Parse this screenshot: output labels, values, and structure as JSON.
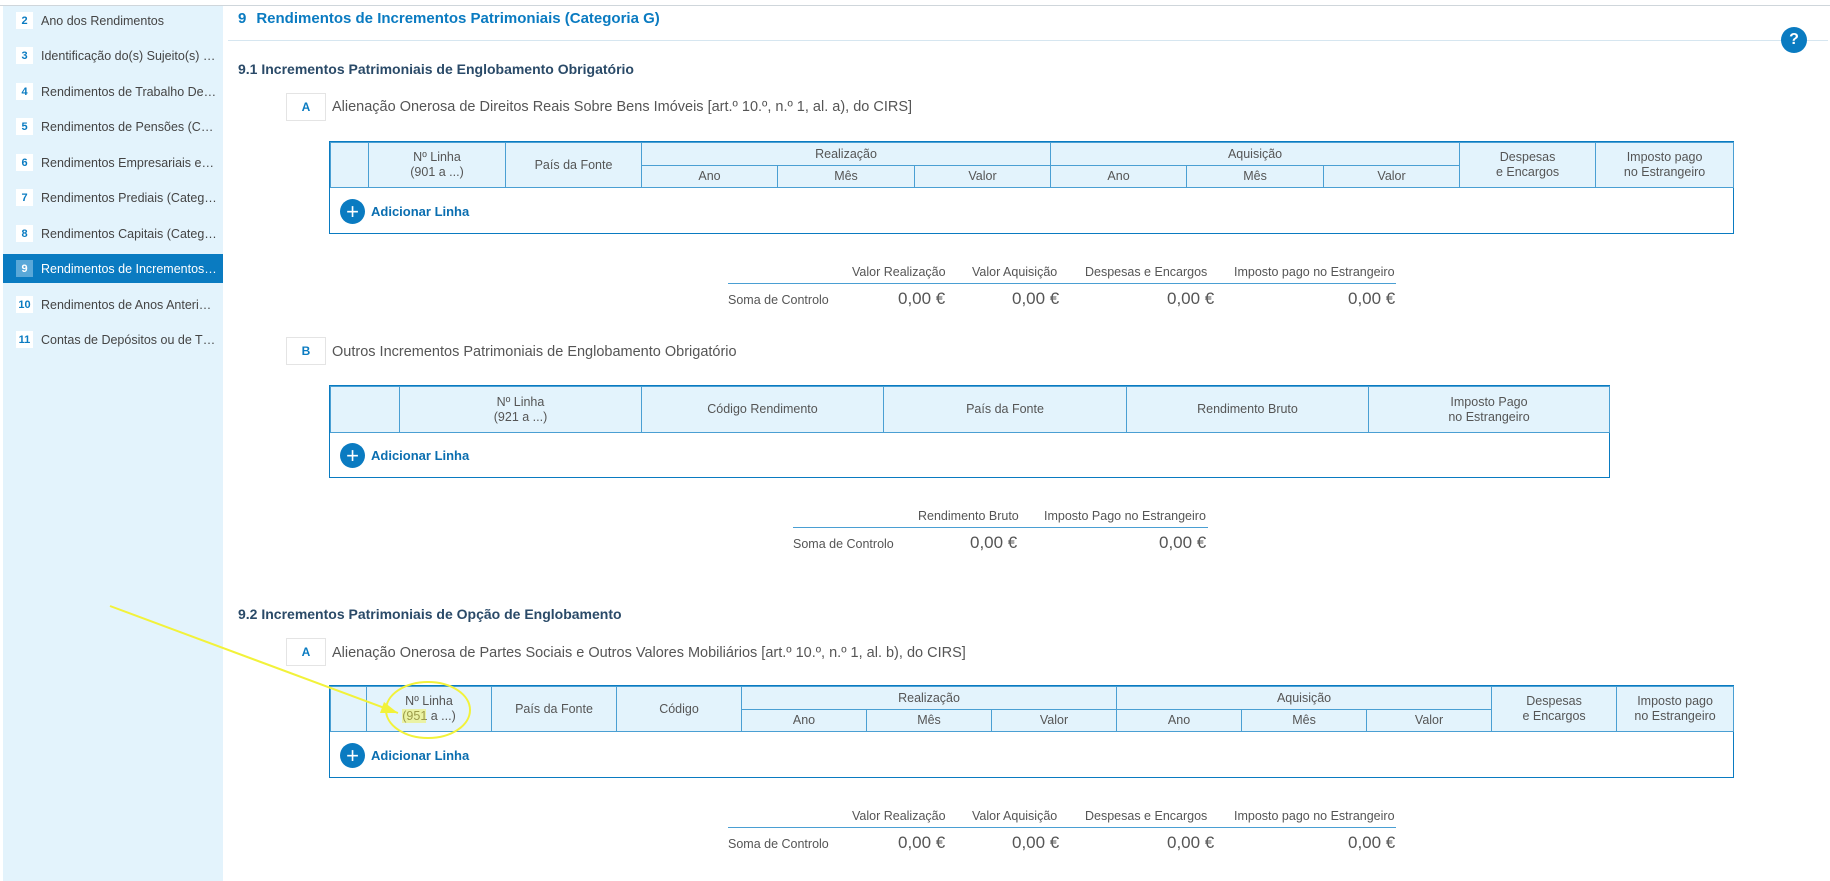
{
  "sidebar": {
    "items": [
      {
        "num": "2",
        "label": "Ano dos Rendimentos"
      },
      {
        "num": "3",
        "label": "Identificação do(s) Sujeito(s) Passivo(s)"
      },
      {
        "num": "4",
        "label": "Rendimentos de Trabalho Dependente"
      },
      {
        "num": "5",
        "label": "Rendimentos de Pensões (Categoria H)"
      },
      {
        "num": "6",
        "label": "Rendimentos Empresariais e Profissionais"
      },
      {
        "num": "7",
        "label": "Rendimentos Prediais (Categoria F)"
      },
      {
        "num": "8",
        "label": "Rendimentos Capitais (Categoria E)"
      },
      {
        "num": "9",
        "label": "Rendimentos de Incrementos Patrimoniais"
      },
      {
        "num": "10",
        "label": "Rendimentos de Anos Anteriores"
      },
      {
        "num": "11",
        "label": "Contas de Depósitos ou de Títulos"
      }
    ],
    "active_index": 7
  },
  "header": {
    "number": "9",
    "title": "Rendimentos de Incrementos Patrimoniais (Categoria G)",
    "help": "?"
  },
  "section_91": {
    "title": "9.1 Incrementos Patrimoniais de Englobamento Obrigatório",
    "A": {
      "letter": "A",
      "title": "Alienação Onerosa de Direitos Reais Sobre Bens Imóveis [art.º 10.º, n.º 1, al. a), do CIRS]",
      "columns": {
        "linha_1": "Nº Linha",
        "linha_2": "(901 a ...)",
        "pais": "País da Fonte",
        "realizacao": "Realização",
        "aquisicao": "Aquisição",
        "despesas_1": "Despesas",
        "despesas_2": "e Encargos",
        "imposto_1": "Imposto pago",
        "imposto_2": "no Estrangeiro",
        "ano": "Ano",
        "mes": "Mês",
        "valor": "Valor"
      },
      "add_label": "Adicionar Linha",
      "summary": {
        "headers": [
          "Valor Realização",
          "Valor Aquisição",
          "Despesas e Encargos",
          "Imposto pago no Estrangeiro"
        ],
        "label": "Soma de Controlo",
        "values": [
          "0,00 €",
          "0,00 €",
          "0,00 €",
          "0,00 €"
        ]
      }
    },
    "B": {
      "letter": "B",
      "title": "Outros Incrementos Patrimoniais de Englobamento Obrigatório",
      "columns": {
        "linha_1": "Nº Linha",
        "linha_2": "(921 a ...)",
        "codigo": "Código Rendimento",
        "pais": "País da Fonte",
        "bruto": "Rendimento Bruto",
        "imposto_1": "Imposto Pago",
        "imposto_2": "no Estrangeiro"
      },
      "add_label": "Adicionar Linha",
      "summary": {
        "headers": [
          "Rendimento Bruto",
          "Imposto Pago no Estrangeiro"
        ],
        "label": "Soma de Controlo",
        "values": [
          "0,00 €",
          "0,00 €"
        ]
      }
    }
  },
  "section_92": {
    "title": "9.2 Incrementos Patrimoniais de Opção de Englobamento",
    "A": {
      "letter": "A",
      "title": "Alienação Onerosa de Partes Sociais e Outros Valores Mobiliários [art.º 10.º, n.º 1, al. b), do CIRS]",
      "columns": {
        "linha_1": "Nº Linha",
        "linha_2": "(951 a ...)",
        "pais": "País da Fonte",
        "codigo": "Código",
        "realizacao": "Realização",
        "aquisicao": "Aquisição",
        "despesas_1": "Despesas",
        "despesas_2": "e Encargos",
        "imposto_1": "Imposto pago",
        "imposto_2": "no Estrangeiro",
        "ano": "Ano",
        "mes": "Mês",
        "valor": "Valor"
      },
      "add_label": "Adicionar Linha",
      "summary": {
        "headers": [
          "Valor Realização",
          "Valor Aquisição",
          "Despesas e Encargos",
          "Imposto pago no Estrangeiro"
        ],
        "label": "Soma de Controlo",
        "values": [
          "0,00 €",
          "0,00 €",
          "0,00 €",
          "0,00 €"
        ]
      }
    }
  },
  "annotation": {
    "color": "#f2f23a"
  }
}
